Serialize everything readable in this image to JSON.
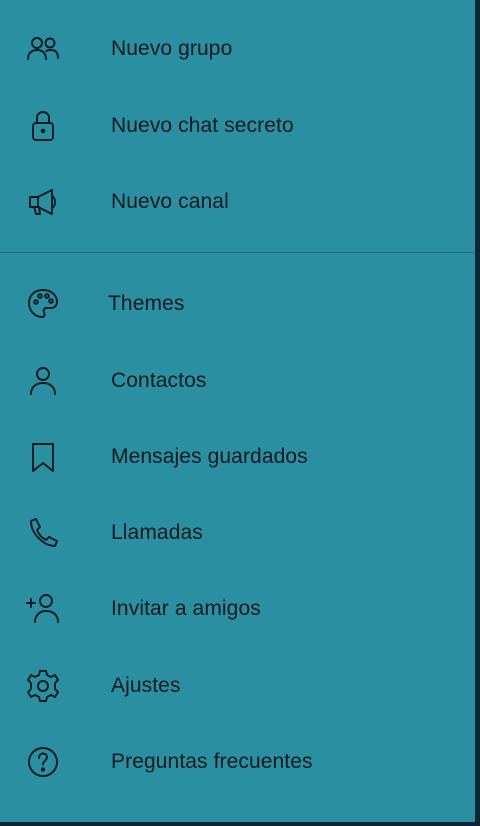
{
  "menu": {
    "group1": [
      {
        "id": "new-group",
        "label": "Nuevo grupo",
        "icon": "users-icon"
      },
      {
        "id": "new-secret-chat",
        "label": "Nuevo chat secreto",
        "icon": "lock-icon"
      },
      {
        "id": "new-channel",
        "label": "Nuevo canal",
        "icon": "megaphone-icon"
      }
    ],
    "group2": [
      {
        "id": "themes",
        "label": "Themes",
        "icon": "palette-icon"
      },
      {
        "id": "contacts",
        "label": "Contactos",
        "icon": "person-icon"
      },
      {
        "id": "saved-messages",
        "label": "Mensajes guardados",
        "icon": "bookmark-icon"
      },
      {
        "id": "calls",
        "label": "Llamadas",
        "icon": "phone-icon"
      },
      {
        "id": "invite-friends",
        "label": "Invitar a amigos",
        "icon": "add-person-icon"
      },
      {
        "id": "settings",
        "label": "Ajustes",
        "icon": "gear-icon"
      },
      {
        "id": "faq",
        "label": "Preguntas frecuentes",
        "icon": "help-circle-icon"
      }
    ]
  },
  "colors": {
    "drawer_background": "#2a8fa1",
    "text": "#0e1a1f",
    "divider": "#1e6f7e"
  }
}
